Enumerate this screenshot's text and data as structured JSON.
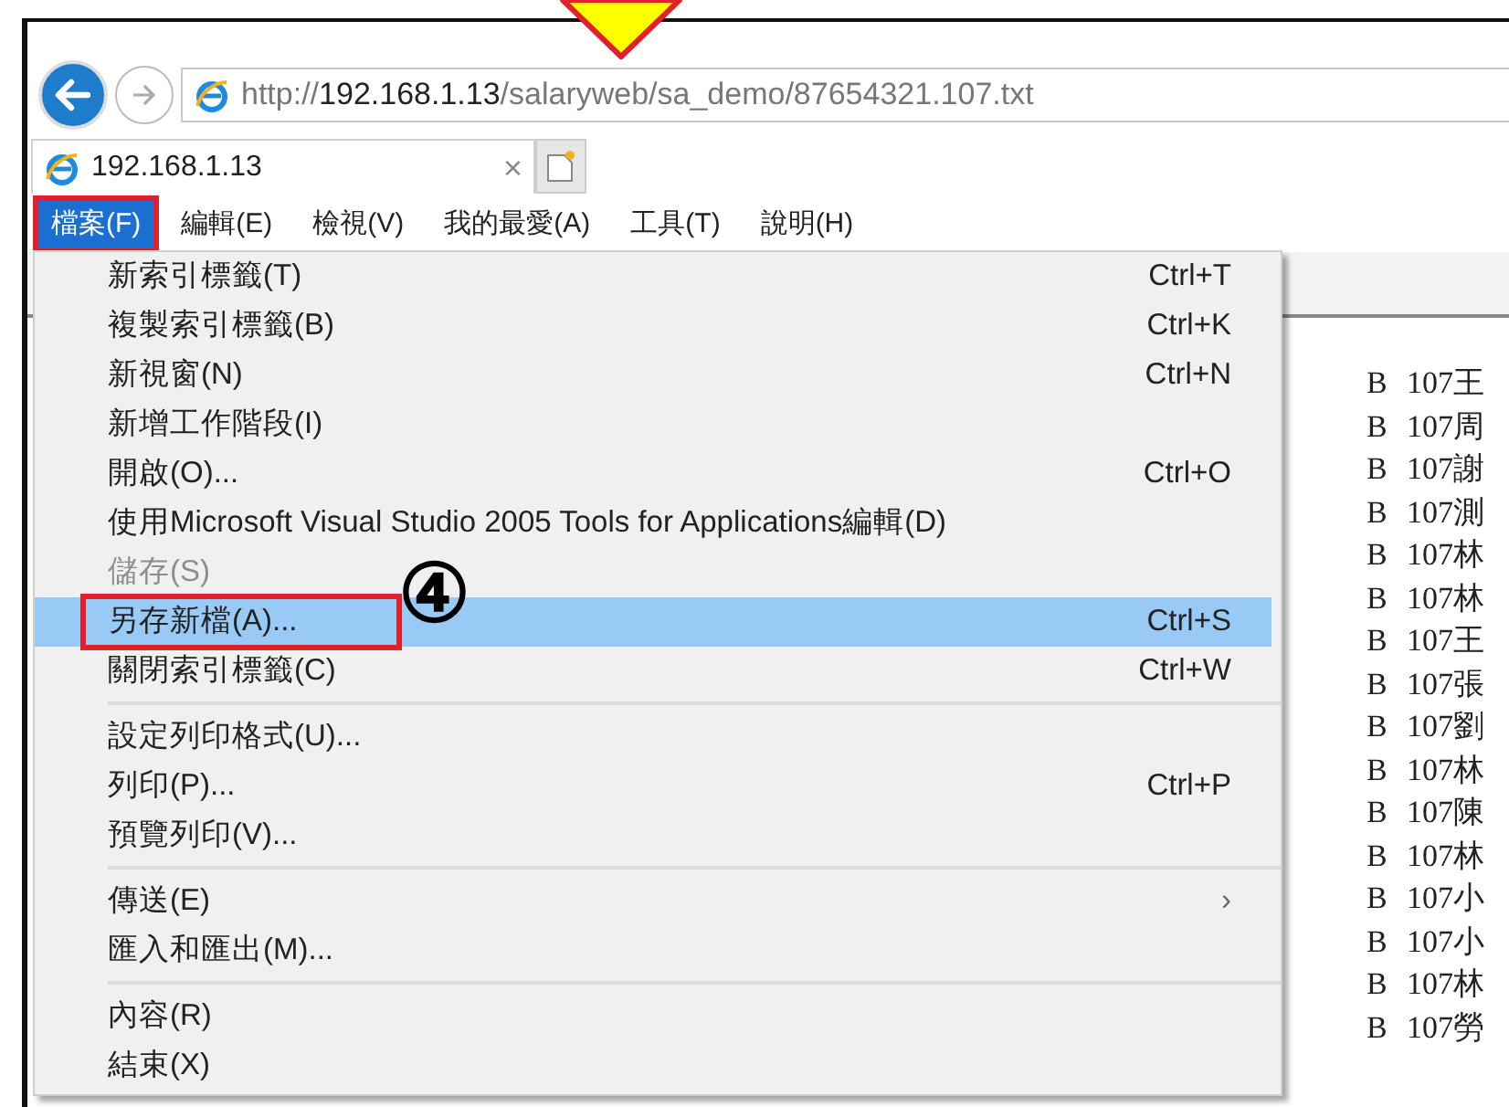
{
  "address_bar": {
    "url_parts": [
      {
        "text": "http://",
        "emphasized": false
      },
      {
        "text": "192.168.1.13",
        "emphasized": true
      },
      {
        "text": "/salaryweb/sa_demo/87654321.107.txt",
        "emphasized": false
      }
    ]
  },
  "tabs": [
    {
      "label": "192.168.1.13",
      "close": "×",
      "selected": true
    }
  ],
  "menu_bar": [
    {
      "label": "檔案(F)",
      "selected": true,
      "highlighted": true
    },
    {
      "label": "編輯(E)",
      "selected": false,
      "highlighted": false
    },
    {
      "label": "檢視(V)",
      "selected": false,
      "highlighted": false
    },
    {
      "label": "我的最愛(A)",
      "selected": false,
      "highlighted": false
    },
    {
      "label": "工具(T)",
      "selected": false,
      "highlighted": false
    },
    {
      "label": "說明(H)",
      "selected": false,
      "highlighted": false
    }
  ],
  "file_menu": {
    "step_marker": "④",
    "items": [
      {
        "kind": "item",
        "label": "新索引標籤(T)",
        "shortcut": "Ctrl+T",
        "disabled": false,
        "selected": false,
        "highlighted": false
      },
      {
        "kind": "item",
        "label": "複製索引標籤(B)",
        "shortcut": "Ctrl+K",
        "disabled": false,
        "selected": false,
        "highlighted": false
      },
      {
        "kind": "item",
        "label": "新視窗(N)",
        "shortcut": "Ctrl+N",
        "disabled": false,
        "selected": false,
        "highlighted": false
      },
      {
        "kind": "item",
        "label": "新增工作階段(I)",
        "disabled": false,
        "selected": false,
        "highlighted": false
      },
      {
        "kind": "item",
        "label": "開啟(O)...",
        "shortcut": "Ctrl+O",
        "disabled": false,
        "selected": false,
        "highlighted": false
      },
      {
        "kind": "item",
        "label": "使用Microsoft Visual Studio 2005 Tools for Applications編輯(D)",
        "disabled": false,
        "selected": false,
        "highlighted": false
      },
      {
        "kind": "item",
        "label": "儲存(S)",
        "disabled": true,
        "selected": false,
        "highlighted": false
      },
      {
        "kind": "item",
        "label": "另存新檔(A)...",
        "shortcut": "Ctrl+S",
        "disabled": false,
        "selected": true,
        "highlighted": true
      },
      {
        "kind": "item",
        "label": "關閉索引標籤(C)",
        "shortcut": "Ctrl+W",
        "disabled": false,
        "selected": false,
        "highlighted": false
      },
      {
        "kind": "separator"
      },
      {
        "kind": "item",
        "label": "設定列印格式(U)...",
        "disabled": false,
        "selected": false,
        "highlighted": false
      },
      {
        "kind": "item",
        "label": "列印(P)...",
        "shortcut": "Ctrl+P",
        "disabled": false,
        "selected": false,
        "highlighted": false
      },
      {
        "kind": "item",
        "label": "預覽列印(V)...",
        "disabled": false,
        "selected": false,
        "highlighted": false
      },
      {
        "kind": "separator"
      },
      {
        "kind": "item",
        "label": "傳送(E)",
        "submenu": "›",
        "disabled": false,
        "selected": false,
        "highlighted": false
      },
      {
        "kind": "item",
        "label": "匯入和匯出(M)...",
        "disabled": false,
        "selected": false,
        "highlighted": false
      },
      {
        "kind": "separator"
      },
      {
        "kind": "item",
        "label": "內容(R)",
        "disabled": false,
        "selected": false,
        "highlighted": false
      },
      {
        "kind": "item",
        "label": "結束(X)",
        "disabled": false,
        "selected": false,
        "highlighted": false
      }
    ]
  },
  "page_lines": [
    {
      "column_1": "B",
      "column_2": "107王"
    },
    {
      "column_1": "B",
      "column_2": "107周"
    },
    {
      "column_1": "B",
      "column_2": "107謝"
    },
    {
      "column_1": "B",
      "column_2": "107測"
    },
    {
      "column_1": "B",
      "column_2": "107林"
    },
    {
      "column_1": "B",
      "column_2": "107林"
    },
    {
      "column_1": "B",
      "column_2": "107王"
    },
    {
      "column_1": "B",
      "column_2": "107張"
    },
    {
      "column_1": "B",
      "column_2": "107劉"
    },
    {
      "column_1": "B",
      "column_2": "107林"
    },
    {
      "column_1": "B",
      "column_2": "107陳"
    },
    {
      "column_1": "B",
      "column_2": "107林"
    },
    {
      "column_1": "B",
      "column_2": "107小"
    },
    {
      "column_1": "B",
      "column_2": "107小"
    },
    {
      "column_1": "B",
      "column_2": "107林"
    },
    {
      "column_1": "B",
      "column_2": "107勞"
    }
  ]
}
